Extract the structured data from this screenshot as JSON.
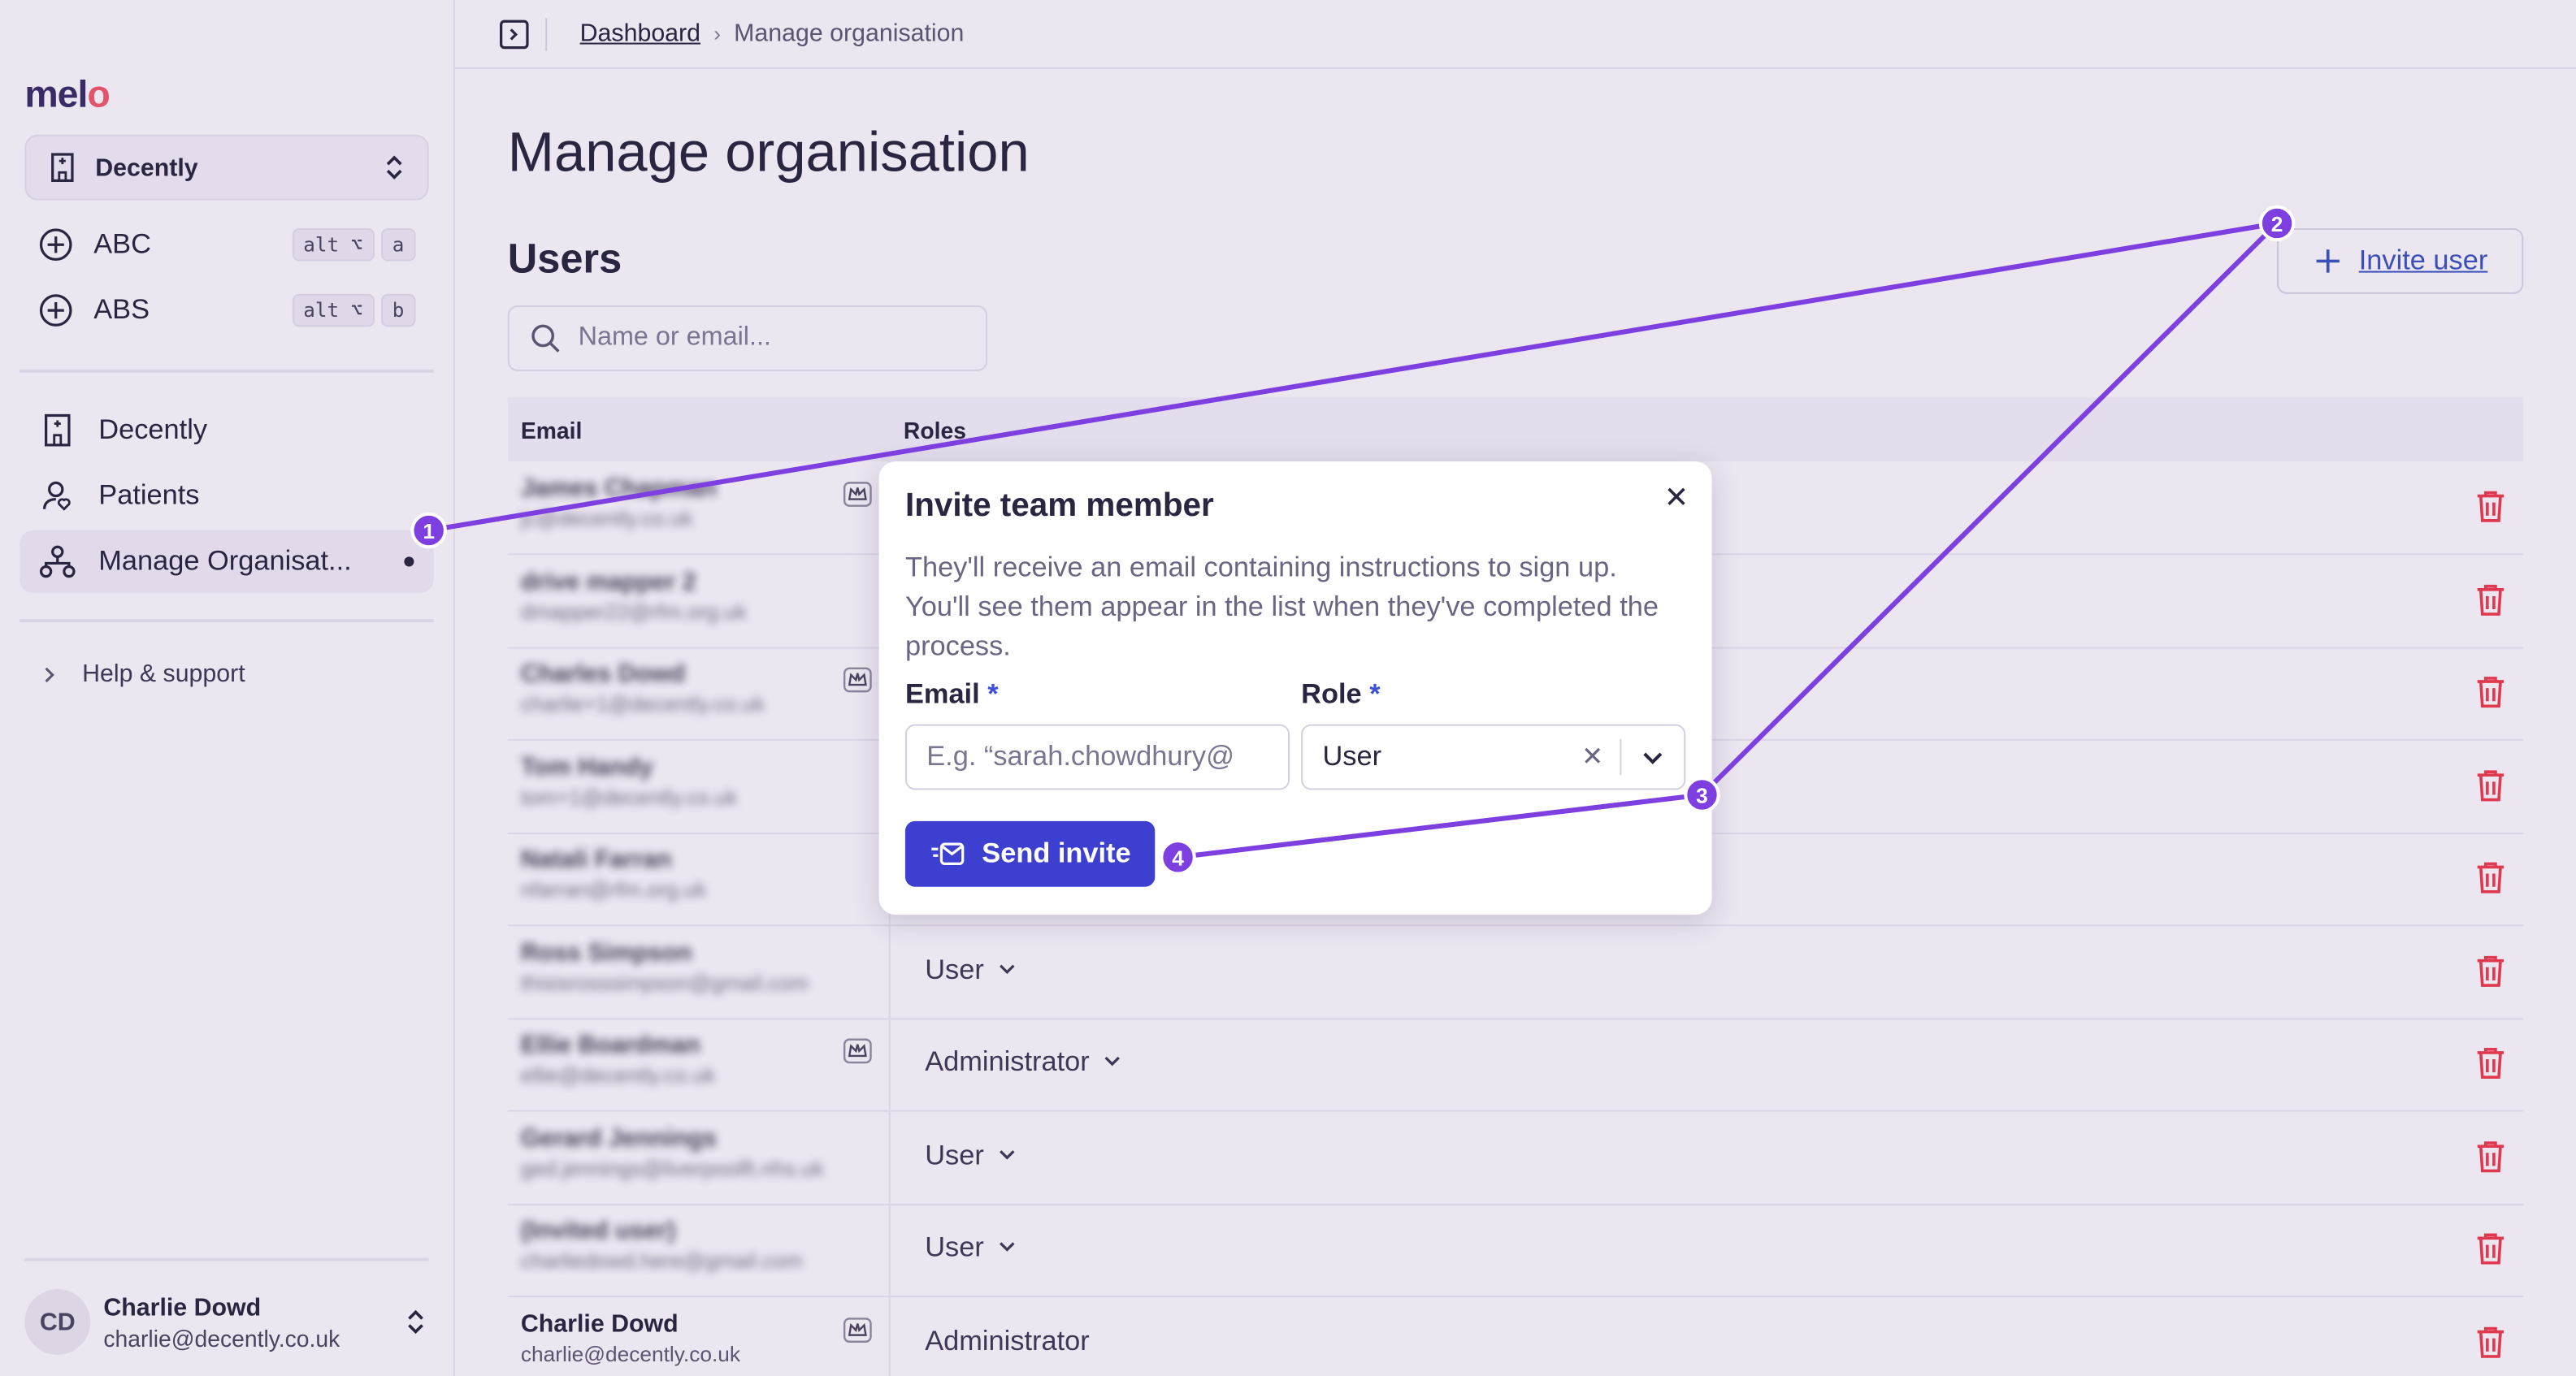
{
  "app": {
    "logo_main": "mel",
    "logo_accent": "o"
  },
  "org_switcher": {
    "label": "Decently"
  },
  "quick_links": [
    {
      "label": "ABC",
      "kbd_mod": "alt ⌥",
      "kbd_key": "a"
    },
    {
      "label": "ABS",
      "kbd_mod": "alt ⌥",
      "kbd_key": "b"
    }
  ],
  "nav": {
    "items": [
      {
        "label": "Decently"
      },
      {
        "label": "Patients"
      },
      {
        "label": "Manage Organisat..."
      }
    ],
    "help": "Help & support"
  },
  "current_user": {
    "initials": "CD",
    "name": "Charlie Dowd",
    "email": "charlie@decently.co.uk"
  },
  "breadcrumb": {
    "link": "Dashboard",
    "separator": "›",
    "current": "Manage organisation"
  },
  "page": {
    "title": "Manage organisation",
    "section": "Users",
    "invite_label": "Invite user"
  },
  "search": {
    "placeholder": "Name or email..."
  },
  "table": {
    "headers": {
      "email": "Email",
      "roles": "Roles"
    },
    "rows": [
      {
        "name": "James Chapman",
        "email": "jc@decently.co.uk",
        "role": "",
        "crown": true
      },
      {
        "name": "drive mapper 2",
        "email": "dmapper22@rfm.org.uk",
        "role": "",
        "crown": false
      },
      {
        "name": "Charles Dowd",
        "email": "charlie+1@decently.co.uk",
        "role": "",
        "crown": true
      },
      {
        "name": "Tom Handy",
        "email": "tom+1@decently.co.uk",
        "role": "",
        "crown": false
      },
      {
        "name": "Natali Farran",
        "email": "nfarran@rfm.org.uk",
        "role": "",
        "crown": false
      },
      {
        "name": "Ross Simpson",
        "email": "thisisrosssimpson@gmail.com",
        "role": "User",
        "crown": false
      },
      {
        "name": "Ellie Boardman",
        "email": "ellie@decently.co.uk",
        "role": "Administrator",
        "crown": true
      },
      {
        "name": "Gerard Jennings",
        "email": "ged.jennings@liverpoolft.nhs.uk",
        "role": "User",
        "crown": false
      },
      {
        "name": "(Invited user)",
        "email": "charliedowd.here@gmail.com",
        "role": "User",
        "crown": false
      },
      {
        "name": "Charlie Dowd",
        "email": "charlie@decently.co.uk",
        "role": "Administrator",
        "crown": true
      }
    ]
  },
  "modal": {
    "title": "Invite team member",
    "description": "They'll receive an email containing instructions to sign up. You'll see them appear in the list when they've completed the process.",
    "email_label": "Email",
    "email_placeholder": "E.g. “sarah.chowdhury@",
    "role_label": "Role",
    "required_mark": "*",
    "role_value": "User",
    "send_label": "Send invite"
  },
  "annotations": [
    "1",
    "2",
    "3",
    "4"
  ],
  "colors": {
    "accent": "#3d3fd0",
    "annotation": "#7d3fe0",
    "danger": "#e0394f",
    "link": "#3b4fb8"
  }
}
